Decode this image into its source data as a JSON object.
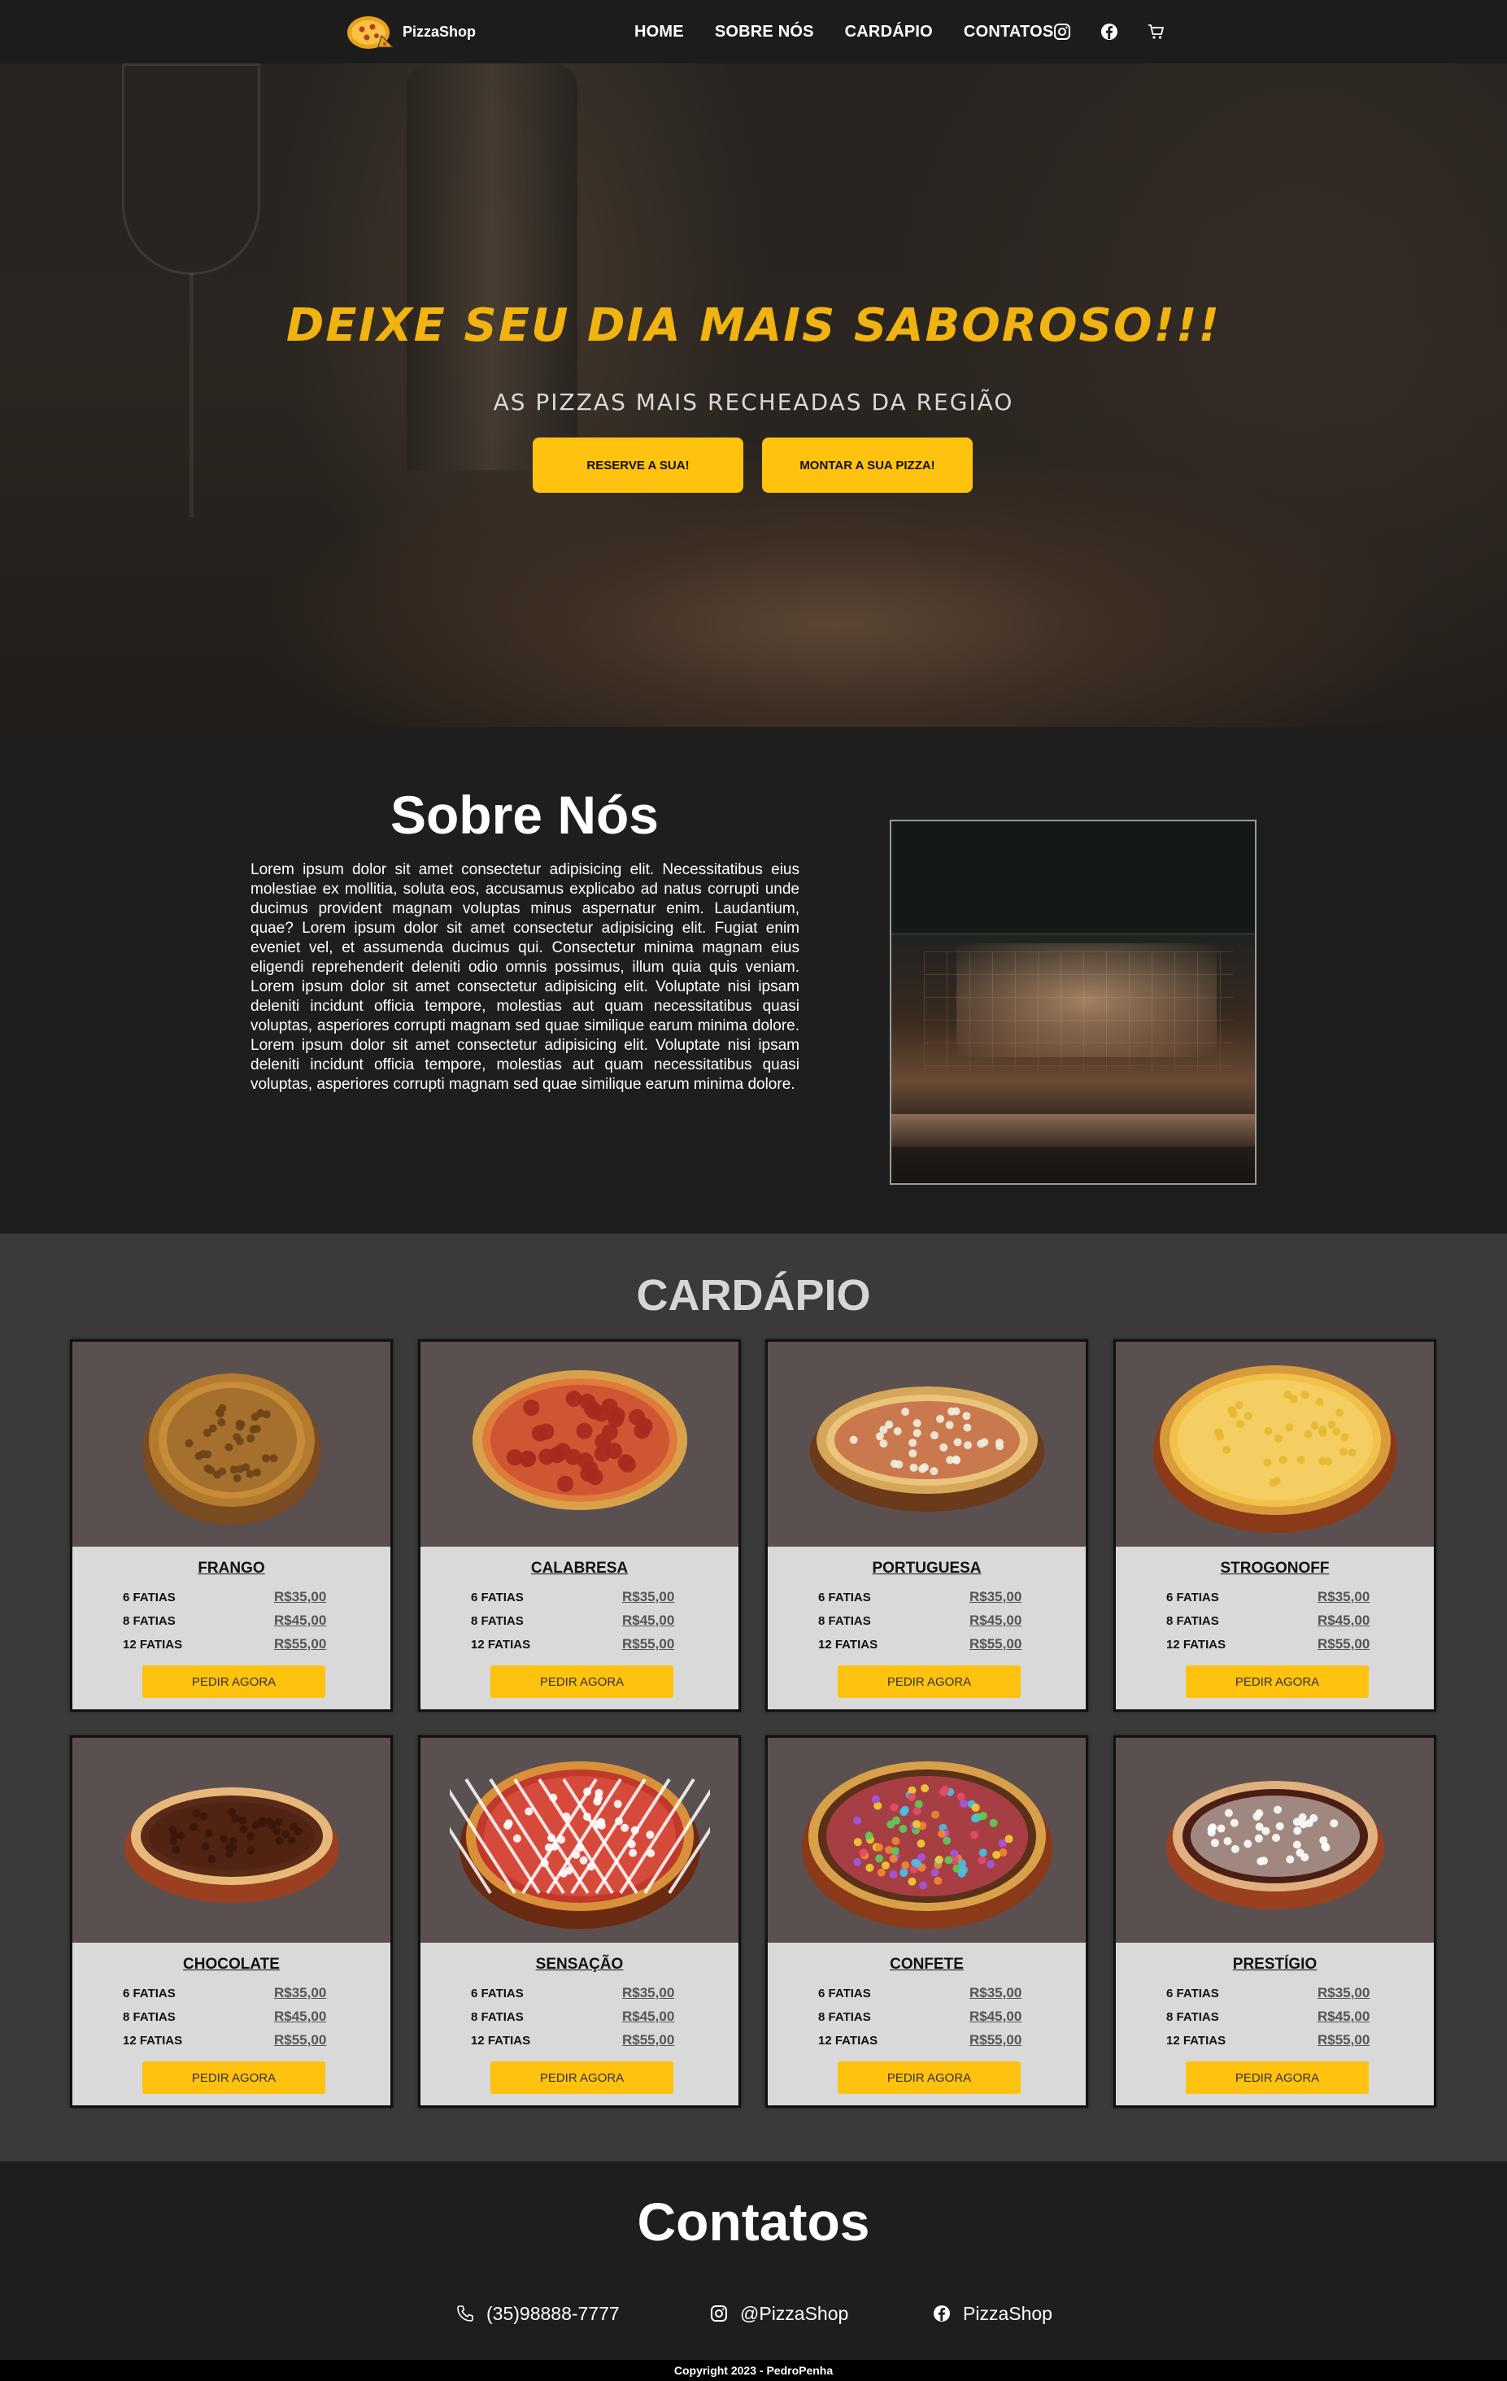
{
  "nav": {
    "brand": "PizzaShop",
    "links": [
      "HOME",
      "SOBRE NÓS",
      "CARDÁPIO",
      "CONTATOS"
    ]
  },
  "hero": {
    "title": "DEIXE SEU DIA MAIS SABOROSO!!!",
    "subtitle": "AS PIZZAS MAIS RECHEADAS DA REGIÃO",
    "btn_reserve": "RESERVE A SUA!",
    "btn_build": "MONTAR A SUA PIZZA!"
  },
  "sobre": {
    "title": "Sobre Nós",
    "text": "Lorem ipsum dolor sit amet consectetur adipisicing elit. Necessitatibus eius molestiae ex mollitia, soluta eos, accusamus explicabo ad natus corrupti unde ducimus provident magnam voluptas minus aspernatur enim. Laudantium, quae? Lorem ipsum dolor sit amet consectetur adipisicing elit. Fugiat enim eveniet vel, et assumenda ducimus qui. Consectetur minima magnam eius eligendi reprehenderit deleniti odio omnis possimus, illum quia quis veniam. Lorem ipsum dolor sit amet consectetur adipisicing elit. Voluptate nisi ipsam deleniti incidunt officia tempore, molestias aut quam necessitatibus quasi voluptas, asperiores corrupti magnam sed quae similique earum minima dolore. Lorem ipsum dolor sit amet consectetur adipisicing elit. Voluptate nisi ipsam deleniti incidunt officia tempore, molestias aut quam necessitatibus quasi voluptas, asperiores corrupti magnam sed quae similique earum minima dolore."
  },
  "cardapio": {
    "title": "CARDÁPIO",
    "sizes": [
      "6 FATIAS",
      "8 FATIAS",
      "12 FATIAS"
    ],
    "prices": [
      "R$35,00",
      "R$45,00",
      "R$55,00"
    ],
    "button": "PEDIR AGORA",
    "pizzas": [
      {
        "name": "FRANGO"
      },
      {
        "name": "CALABRESA"
      },
      {
        "name": "PORTUGUESA"
      },
      {
        "name": "STROGONOFF"
      },
      {
        "name": "CHOCOLATE"
      },
      {
        "name": "SENSAÇÃO"
      },
      {
        "name": "CONFETE"
      },
      {
        "name": "PRESTÍGIO"
      }
    ]
  },
  "contatos": {
    "title": "Contatos",
    "phone": "(35)98888-7777",
    "instagram": "@PizzaShop",
    "facebook": "PizzaShop"
  },
  "footer": {
    "copyright": "Copyright 2023 - PedroPenha"
  },
  "colors": {
    "accent": "#ffc20e",
    "background": "#1e1e1e",
    "menu_bg": "#3a3a3a",
    "card_image_bg": "#5b5050"
  }
}
